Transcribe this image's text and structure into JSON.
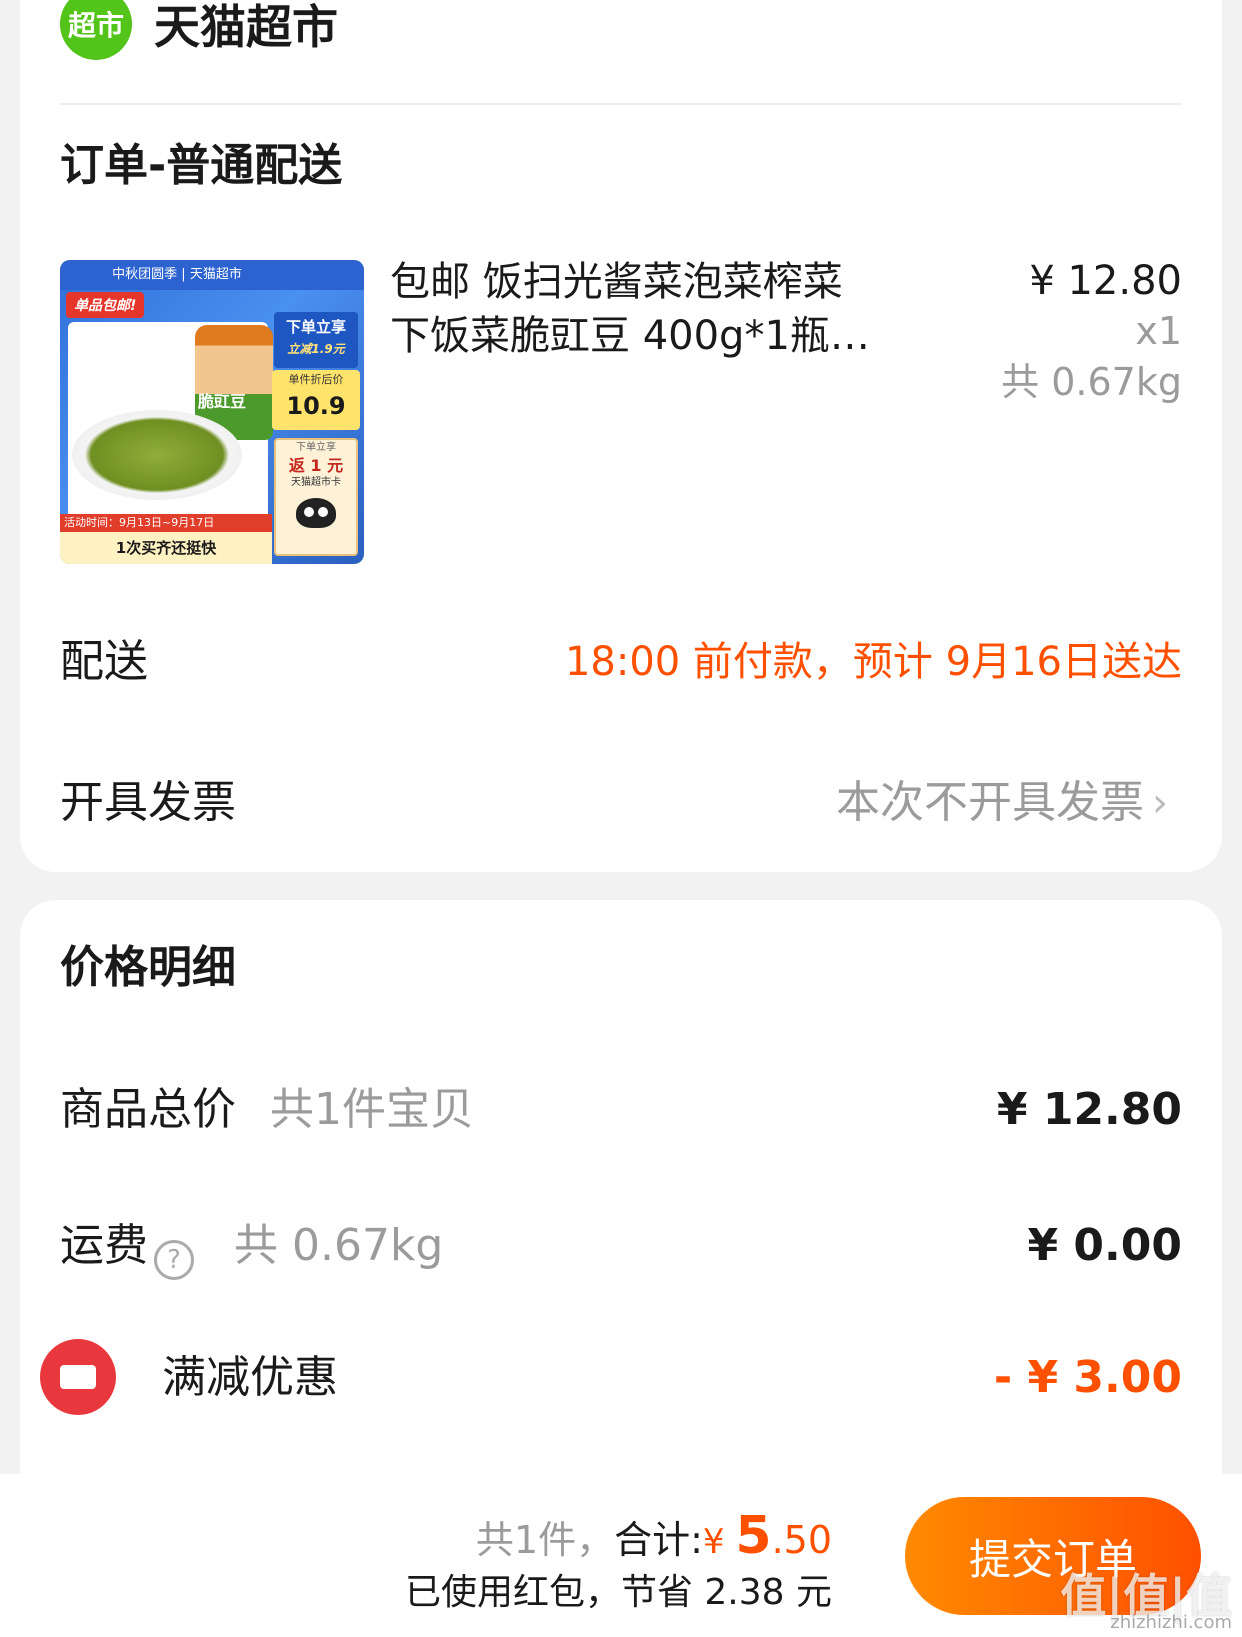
{
  "shop": {
    "logo_text": "超市",
    "name": "天猫超市"
  },
  "order": {
    "section_title": "订单-普通配送",
    "product": {
      "thumbnail": {
        "top_band": "中秋团圆季 | 天猫超市",
        "free_shipping_tag": "单品包邮!",
        "promo_title": "下单立享",
        "promo_sub": "立减1.9元",
        "unit_price_label": "单件折后价",
        "unit_price": "10.9",
        "rebate_top": "下单立享",
        "rebate_main": "返 1 元",
        "rebate_card": "天猫超市卡",
        "jar_label": "脆豇豆",
        "activity_time": "活动时间：9月13日~9月17日",
        "bottom_slogan": "1次买齐还挺快"
      },
      "title_line1": "包邮 饭扫光酱菜泡菜榨菜",
      "title_line2": "下饭菜脆豇豆 400g*1瓶…",
      "price": "¥ 12.80",
      "quantity": "x1",
      "weight": "共 0.67kg"
    },
    "delivery": {
      "label": "配送",
      "value": "18:00 前付款，预计 9月16日送达"
    },
    "invoice": {
      "label": "开具发票",
      "value": "本次不开具发票"
    }
  },
  "price_detail": {
    "title": "价格明细",
    "goods_total": {
      "label": "商品总价",
      "note": "共1件宝贝",
      "value": "¥ 12.80"
    },
    "shipping": {
      "label": "运费",
      "note": "共 0.67kg",
      "value": "¥ 0.00"
    },
    "discount": {
      "label": "满减优惠",
      "value": "- ¥ 3.00"
    }
  },
  "footer": {
    "count": "共1件，",
    "total_label": "合计:",
    "currency": "¥ ",
    "total_int": "5",
    "total_dec": ".50",
    "saved_text": "已使用红包，节省 2.38 元",
    "submit_label": "提交订单"
  },
  "watermark": {
    "text": "值|值|值",
    "site": "zhizhizhi.com"
  },
  "colors": {
    "accent": "#ff5000",
    "brand_green": "#52c41a",
    "coupon_red": "#e8383d"
  },
  "icons": {
    "logo": "tmall-market-logo",
    "help": "question-circle-icon",
    "coupon": "coupon-icon",
    "chevron": "chevron-right-icon"
  }
}
